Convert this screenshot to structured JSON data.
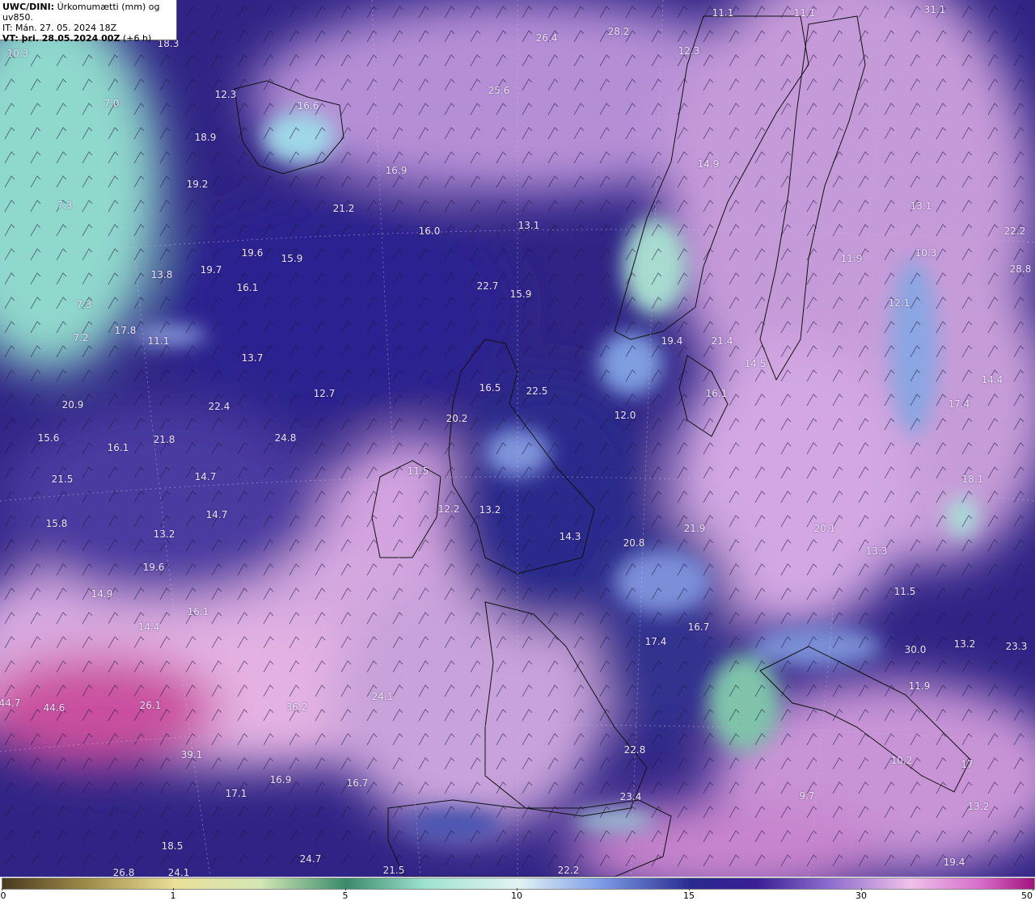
{
  "header": {
    "line1_bold": "UWC/DINI:",
    "line1_rest": " Úrkomumætti (mm) og uv850.",
    "line2": "IT: Mán. 27. 05. 2024 18Z",
    "line3_bold": "VT: þri. 28.05.2024 00Z",
    "line3_rest": " (+6 h)"
  },
  "colorbar": {
    "ticks": [
      "0",
      "1",
      "5",
      "10",
      "15",
      "30",
      "50"
    ],
    "colors": [
      "#4a3a20",
      "#e9df98",
      "#3a8a6a",
      "#e2f3f3",
      "#2b2a8f",
      "#f0c0ea",
      "#a2127c"
    ]
  },
  "map_values": [
    "18.3",
    "10.3",
    "7.0",
    "7.3",
    "7.3",
    "7.2",
    "12.3",
    "16.6",
    "18.9",
    "19.2",
    "16.9",
    "21.2",
    "16.0",
    "13.1",
    "19.6",
    "15.9",
    "19.7",
    "13.8",
    "16.1",
    "22.7",
    "15.9",
    "17.8",
    "11.1",
    "13.7",
    "12.7",
    "16.5",
    "22.5",
    "20.2",
    "12.0",
    "20.9",
    "22.4",
    "15.6",
    "16.1",
    "21.8",
    "24.8",
    "21.5",
    "14.7",
    "14.7",
    "15.8",
    "13.2",
    "11.5",
    "12.2",
    "13.2",
    "14.3",
    "20.8",
    "21.9",
    "19.6",
    "14.9",
    "16.1",
    "14.4",
    "17.4",
    "16.7",
    "26.4",
    "28.2",
    "25.6",
    "11.1",
    "11.1",
    "31.1",
    "12.3",
    "14.9",
    "19.4",
    "21.4",
    "14.5",
    "16.1",
    "11.9",
    "10.3",
    "12.1",
    "13.1",
    "22.2",
    "28.8",
    "14.4",
    "17.4",
    "18.1",
    "20.1",
    "13.3",
    "11.5",
    "13.2",
    "23.3",
    "11.9",
    "10.2",
    "17",
    "13.2",
    "19.4",
    "44.7",
    "44.6",
    "26.1",
    "36.2",
    "24.1",
    "39.1",
    "17.1",
    "16.9",
    "16.7",
    "22.8",
    "23.4",
    "18.5",
    "24.7",
    "26.8",
    "24.1",
    "21.5",
    "22.2",
    "30.0",
    "9.7"
  ]
}
